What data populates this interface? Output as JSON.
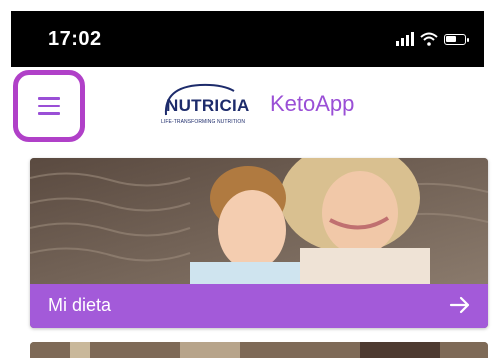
{
  "status_bar": {
    "time": "17:02",
    "icons": [
      "signal-icon",
      "wifi-icon",
      "battery-icon"
    ]
  },
  "header": {
    "menu_icon": "hamburger-menu-icon",
    "logo_text": "NUTRICIA",
    "logo_tagline": "LIFE-TRANSFORMING NUTRITION",
    "app_name": "KetoApp"
  },
  "cards": [
    {
      "label": "Mi dieta",
      "arrow_icon": "arrow-right-icon"
    }
  ],
  "colors": {
    "accent": "#a35ad9",
    "menu_highlight": "#b040c8",
    "logo_navy": "#1d2b6b"
  }
}
